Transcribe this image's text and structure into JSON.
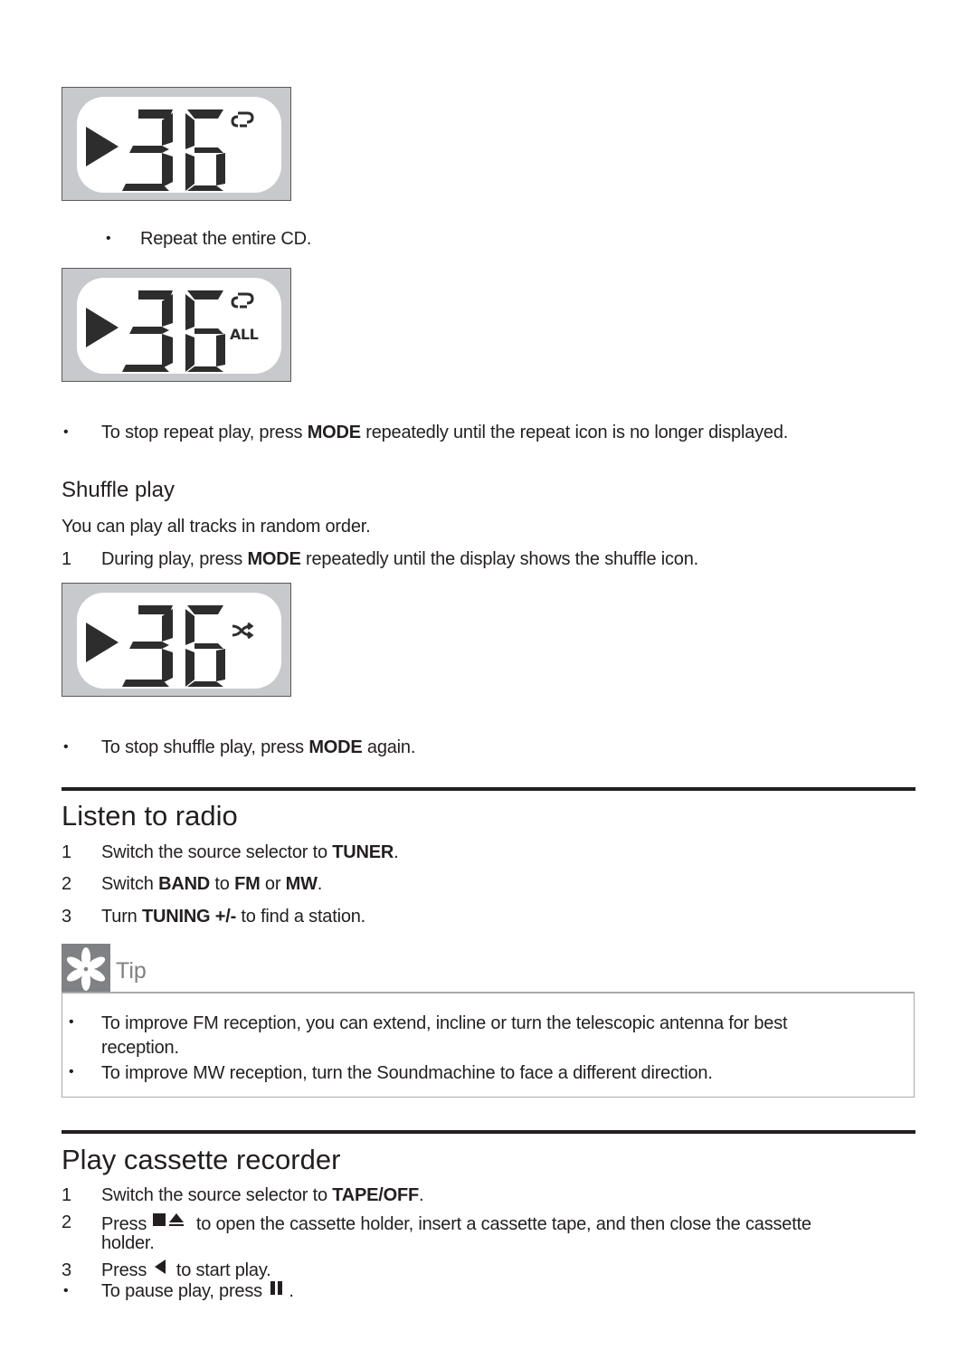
{
  "repeat_cd": {
    "display_1": {
      "track": "36",
      "indicator_icon": "repeat-icon"
    },
    "bullet": "Repeat the entire CD.",
    "display_2": {
      "track": "36",
      "indicator_icon": "repeat-icon",
      "indicator_text": "ALL"
    },
    "stop_note": {
      "pre": "To stop repeat play, press ",
      "key": "MODE",
      "post": " repeatedly until the repeat icon is no longer displayed."
    }
  },
  "shuffle": {
    "heading": "Shuffle play",
    "intro": "You can play all tracks in random order.",
    "step_1": {
      "num": "1",
      "pre": "During play, press ",
      "key": "MODE",
      "post": " repeatedly until the display shows the shuffle icon."
    },
    "display": {
      "track": "36",
      "indicator_icon": "shuffle-icon"
    },
    "stop_note": {
      "pre": "To stop shuffle play, press ",
      "key": "MODE",
      "post": " again."
    }
  },
  "radio": {
    "heading": "Listen to radio",
    "steps": [
      {
        "num": "1",
        "pre": "Switch the source selector to ",
        "k1": "TUNER",
        "post": "."
      },
      {
        "num": "2",
        "pre": "Switch ",
        "k1": "BAND",
        "mid1": " to ",
        "k2": "FM",
        "mid2": " or ",
        "k3": "MW",
        "post": "."
      },
      {
        "num": "3",
        "pre": "Turn ",
        "k1": "TUNING +/-",
        "post": " to find a station."
      }
    ],
    "tip": {
      "label": "Tip",
      "icon": "tip-asterisk-icon",
      "items": [
        {
          "line1": "To improve FM reception, you can extend, incline or turn the telescopic antenna for best",
          "line2": "reception."
        },
        {
          "line1": "To improve MW reception, turn the Soundmachine to face a different direction."
        }
      ]
    }
  },
  "cassette": {
    "heading": "Play cassette recorder",
    "steps": [
      {
        "num": "1",
        "pre": "Switch the source selector to ",
        "k1": "TAPE/OFF",
        "post": "."
      },
      {
        "num": "2",
        "pre": "Press ",
        "icon": "stop-eject-icon",
        "post": " to open the cassette holder, insert a cassette tape, and then close the cassette",
        "line2": "holder."
      },
      {
        "num": "3",
        "pre": "Press ",
        "icon": "play-left-icon",
        "post": " to start play."
      }
    ],
    "pause_note": {
      "pre": "To pause play, press ",
      "icon": "pause-icon",
      "post": "."
    }
  },
  "bullet_char": "•"
}
